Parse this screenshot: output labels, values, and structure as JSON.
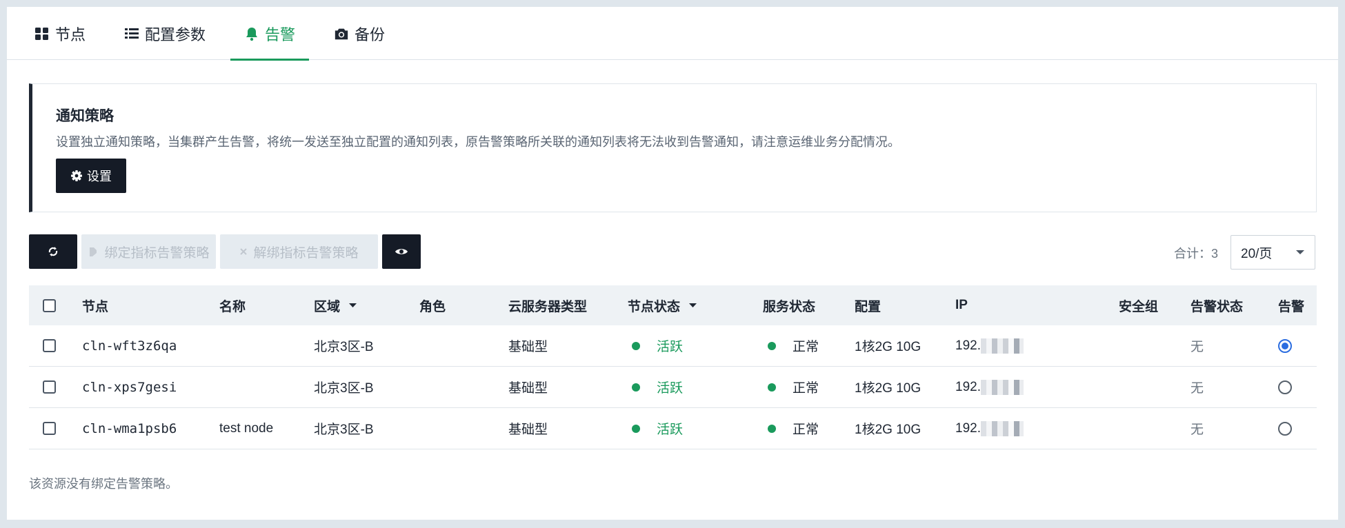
{
  "tabs": [
    {
      "label": "节点",
      "icon": "grid-icon",
      "active": false
    },
    {
      "label": "配置参数",
      "icon": "list-icon",
      "active": false
    },
    {
      "label": "告警",
      "icon": "bell-icon",
      "active": true
    },
    {
      "label": "备份",
      "icon": "camera-icon",
      "active": false
    }
  ],
  "notice": {
    "title": "通知策略",
    "description": "设置独立通知策略，当集群产生告警，将统一发送至独立配置的通知列表，原告警策略所关联的通知列表将无法收到告警通知，请注意运维业务分配情况。",
    "settings_button": "设置"
  },
  "toolbar": {
    "bind_label": "绑定指标告警策略",
    "unbind_label": "解绑指标告警策略",
    "total": "合计：3",
    "page_size": "20/页"
  },
  "table": {
    "headers": {
      "node": "节点",
      "name": "名称",
      "region": "区域",
      "role": "角色",
      "server_type": "云服务器类型",
      "node_status": "节点状态",
      "service_status": "服务状态",
      "config": "配置",
      "ip": "IP",
      "security_group": "安全组",
      "alarm_status": "告警状态",
      "alarm": "告警"
    },
    "rows": [
      {
        "node": "cln-wft3z6qa",
        "name": "",
        "region": "北京3区-B",
        "role": "",
        "server_type": "基础型",
        "node_status": "活跃",
        "service_status": "正常",
        "config": "1核2G 10G",
        "ip": "192.",
        "security_group": "",
        "alarm_status": "无",
        "alarm_selected": true
      },
      {
        "node": "cln-xps7gesi",
        "name": "",
        "region": "北京3区-B",
        "role": "",
        "server_type": "基础型",
        "node_status": "活跃",
        "service_status": "正常",
        "config": "1核2G 10G",
        "ip": "192.",
        "security_group": "",
        "alarm_status": "无",
        "alarm_selected": false
      },
      {
        "node": "cln-wma1psb6",
        "name": "test node",
        "region": "北京3区-B",
        "role": "",
        "server_type": "基础型",
        "node_status": "活跃",
        "service_status": "正常",
        "config": "1核2G 10G",
        "ip": "192.",
        "security_group": "",
        "alarm_status": "无",
        "alarm_selected": false
      }
    ]
  },
  "footer_note": "该资源没有绑定告警策略。",
  "colors": {
    "accent": "#1a9a5c",
    "dark": "#151b26",
    "radio": "#2b6de0"
  }
}
